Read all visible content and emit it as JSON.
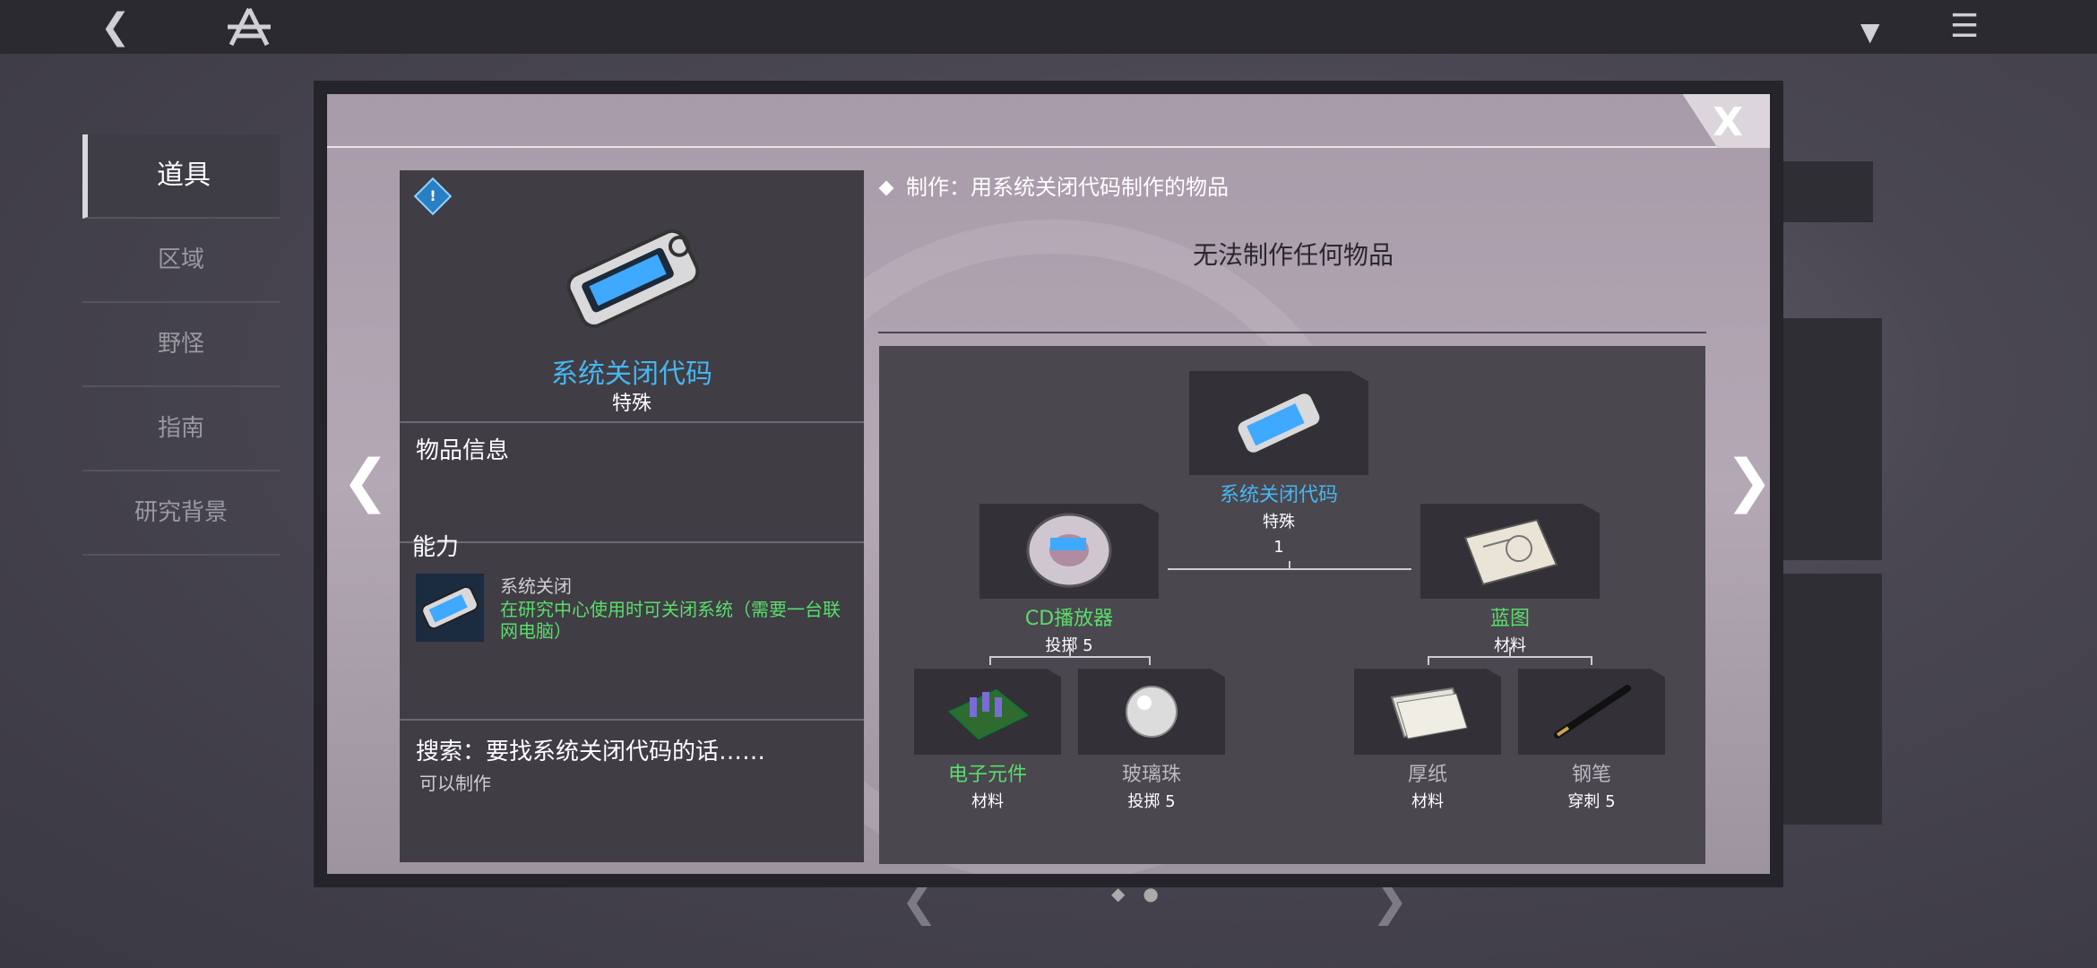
{
  "topbar": {
    "back_icon": "chevron-left-icon",
    "logo_icon": "a-logo-icon",
    "dropdown_icon": "triangle-down-icon",
    "menu_icon": "hamburger-menu-icon"
  },
  "background_nav": {
    "items": [
      {
        "label": "道具"
      },
      {
        "label": "区域"
      },
      {
        "label": "野怪"
      },
      {
        "label": "指南"
      },
      {
        "label": "研究背景"
      }
    ]
  },
  "modal": {
    "close_label": "X",
    "item": {
      "name": "系统关闭代码",
      "type": "特殊",
      "info_title": "物品信息",
      "ability_title": "能力",
      "ability_name": "系统关闭",
      "ability_desc": "在研究中心使用时可关闭系统（需要一台联网电脑）",
      "search_title": "搜索：要找系统关闭代码的话……",
      "search_result": "可以制作"
    },
    "craft": {
      "title": "制作：用系统关闭代码制作的物品",
      "empty": "无法制作任何物品"
    },
    "tree": {
      "root": {
        "name": "系统关闭代码",
        "type": "特殊",
        "count": "1"
      },
      "left": {
        "name": "CD播放器",
        "type": "投掷 5"
      },
      "right": {
        "name": "蓝图",
        "type": "材料"
      },
      "ll": {
        "name": "电子元件",
        "type": "材料"
      },
      "lr": {
        "name": "玻璃珠",
        "type": "投掷 5"
      },
      "rl": {
        "name": "厚纸",
        "type": "材料"
      },
      "rr": {
        "name": "钢笔",
        "type": "穿刺 5"
      },
      "more_label": "···"
    }
  },
  "colors": {
    "accent_blue": "#46b6f0",
    "accent_green": "#59de6a"
  }
}
